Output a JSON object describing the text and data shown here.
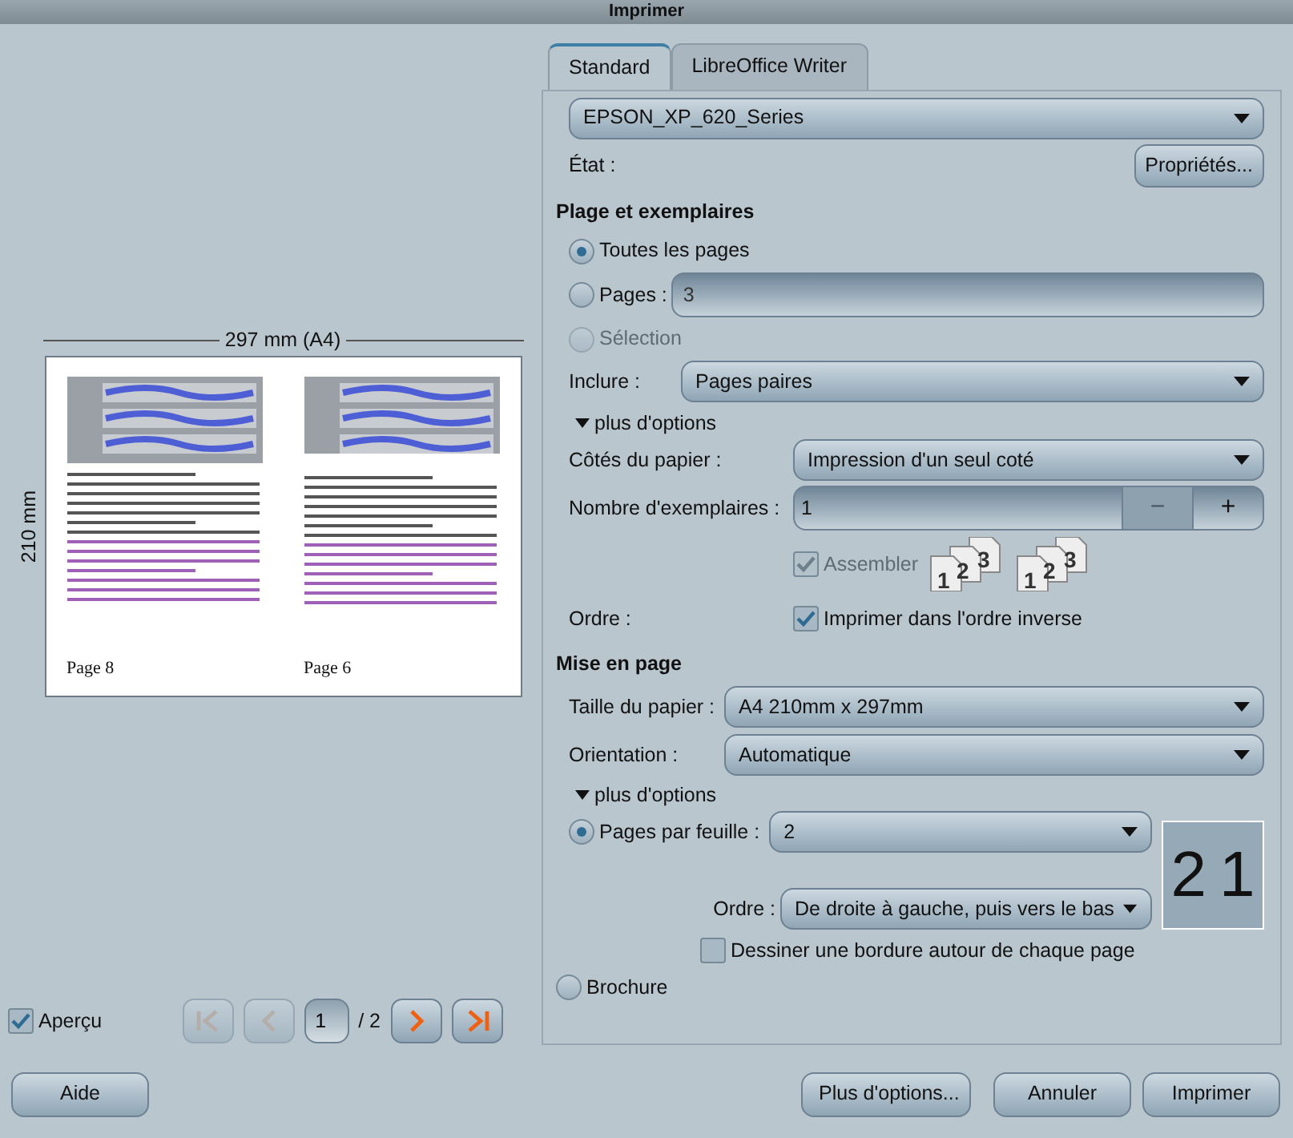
{
  "window": {
    "title": "Imprimer"
  },
  "preview": {
    "width_label": "297 mm (A4)",
    "height_label": "210 mm",
    "pages": [
      {
        "label": "Page 8"
      },
      {
        "label": "Page 6"
      }
    ]
  },
  "preview_toggle": {
    "label": "Aperçu",
    "checked": true
  },
  "pager": {
    "page": "1",
    "total": "/ 2",
    "buttons": [
      {
        "kind": "first",
        "disabled": true
      },
      {
        "kind": "prev",
        "disabled": true
      },
      {
        "kind": "next",
        "disabled": false
      },
      {
        "kind": "last",
        "disabled": false
      }
    ]
  },
  "tabs": [
    {
      "label": "Standard",
      "selected": true
    },
    {
      "label": "LibreOffice Writer",
      "selected": false
    }
  ],
  "printer": {
    "value": "EPSON_XP_620_Series",
    "status_label": "État :",
    "properties_button": "Propriétés..."
  },
  "range": {
    "title": "Plage et exemplaires",
    "options": [
      {
        "label": "Toutes les pages",
        "selected": true,
        "disabled": false
      },
      {
        "label": "Pages :",
        "selected": false,
        "disabled": false,
        "value": "3"
      },
      {
        "label": "Sélection",
        "selected": false,
        "disabled": true
      }
    ],
    "include": {
      "label": "Inclure :",
      "value": "Pages paires"
    },
    "more": {
      "label": "plus d'options",
      "expanded": true
    },
    "sides": {
      "label": "Côtés du papier :",
      "value": "Impression d'un seul coté"
    },
    "copies": {
      "label": "Nombre d'exemplaires :",
      "value": "1",
      "minus": "−",
      "plus": "+"
    },
    "collate": {
      "label": "Assembler",
      "checked": true,
      "disabled": true,
      "icons": [
        {
          "digits": [
            "1",
            "2",
            "3"
          ]
        },
        {
          "digits": [
            "1",
            "2",
            "3"
          ]
        }
      ]
    },
    "order": {
      "label": "Ordre :",
      "checkbox_label": "Imprimer dans l'ordre inverse",
      "checked": true
    }
  },
  "layout": {
    "title": "Mise en page",
    "paper_size": {
      "label": "Taille du papier :",
      "value": "A4 210mm x 297mm"
    },
    "orientation": {
      "label": "Orientation :",
      "value": "Automatique"
    },
    "more": {
      "label": "plus d'options",
      "expanded": true
    },
    "pages_per_sheet": {
      "label": "Pages par feuille :",
      "value": "2",
      "selected": true
    },
    "sheet_preview": [
      "2",
      "1"
    ],
    "order": {
      "label": "Ordre :",
      "value": "De droite à gauche, puis vers le bas"
    },
    "border": {
      "label": "Dessiner une bordure autour de chaque page",
      "checked": false
    },
    "brochure": {
      "label": "Brochure",
      "selected": false
    }
  },
  "footer": {
    "help": "Aide",
    "more": "Plus d'options...",
    "cancel": "Annuler",
    "print": "Imprimer"
  }
}
